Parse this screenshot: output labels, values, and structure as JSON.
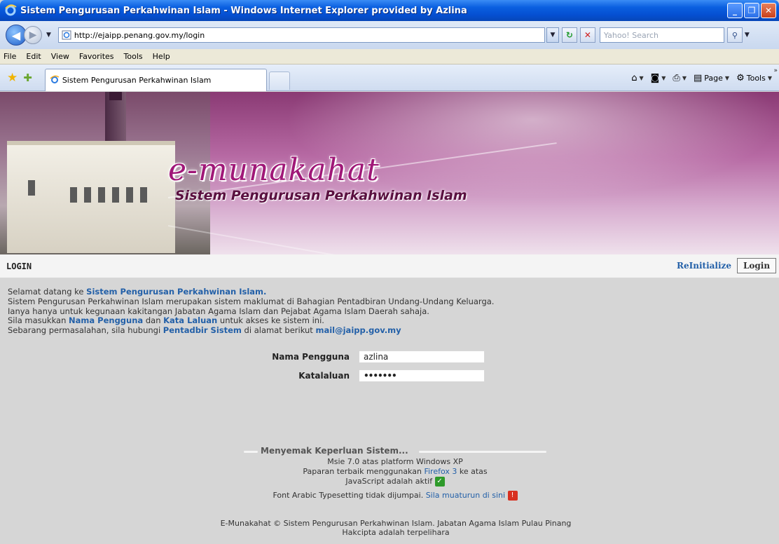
{
  "window": {
    "title": "Sistem Pengurusan Perkahwinan Islam - Windows Internet Explorer provided by Azlina",
    "minimize": "_",
    "maximize": "❐",
    "close": "✕"
  },
  "address": {
    "url": "http://ejaipp.penang.gov.my/login",
    "search_placeholder": "Yahoo! Search"
  },
  "menu": [
    "File",
    "Edit",
    "View",
    "Favorites",
    "Tools",
    "Help"
  ],
  "tabs": {
    "active_label": "Sistem Pengurusan Perkahwinan Islam"
  },
  "commandbar": {
    "page_label": "Page",
    "tools_label": "Tools"
  },
  "banner": {
    "logo": "e-munakahat",
    "subtitle": "Sistem Pengurusan Perkahwinan Islam"
  },
  "loginbar": {
    "heading": "LOGIN",
    "reinitialize": "ReInitialize",
    "login_button": "Login"
  },
  "intro": {
    "line1_prefix": "Selamat datang ke ",
    "line1_link": "Sistem Pengurusan Perkahwinan Islam.",
    "line2": "Sistem Pengurusan Perkahwinan Islam merupakan sistem maklumat di Bahagian Pentadbiran Undang-Undang Keluarga.",
    "line3": "Ianya hanya untuk kegunaan kakitangan Jabatan Agama Islam dan Pejabat Agama Islam Daerah sahaja.",
    "line4_prefix": "Sila masukkan ",
    "line4_link1": "Nama Pengguna",
    "line4_mid": " dan ",
    "line4_link2": "Kata Laluan",
    "line4_suffix": " untuk akses ke sistem ini.",
    "line5_prefix": "Sebarang permasalahan, sila hubungi ",
    "line5_link1": "Pentadbir Sistem",
    "line5_mid": " di alamat berikut ",
    "line5_link2": "mail@jaipp.gov.my"
  },
  "form": {
    "username_label": "Nama Pengguna",
    "username_value": "azlina",
    "password_label": "Katalaluan",
    "password_value": "•••••••"
  },
  "requirements": {
    "title": "Menyemak Keperluan Sistem...",
    "browser": "Msie 7.0 atas platform Windows XP",
    "best_prefix": "Paparan terbaik menggunakan ",
    "best_link": "Firefox 3",
    "best_suffix": " ke atas",
    "js": "JavaScript adalah aktif",
    "font_prefix": "Font Arabic Typesetting tidak dijumpai. ",
    "font_link": "Sila muaturun di sini"
  },
  "footer": {
    "line1": "E-Munakahat © Sistem Pengurusan Perkahwinan Islam. Jabatan Agama Islam Pulau Pinang",
    "line2": "Hakcipta adalah terpelihara"
  }
}
